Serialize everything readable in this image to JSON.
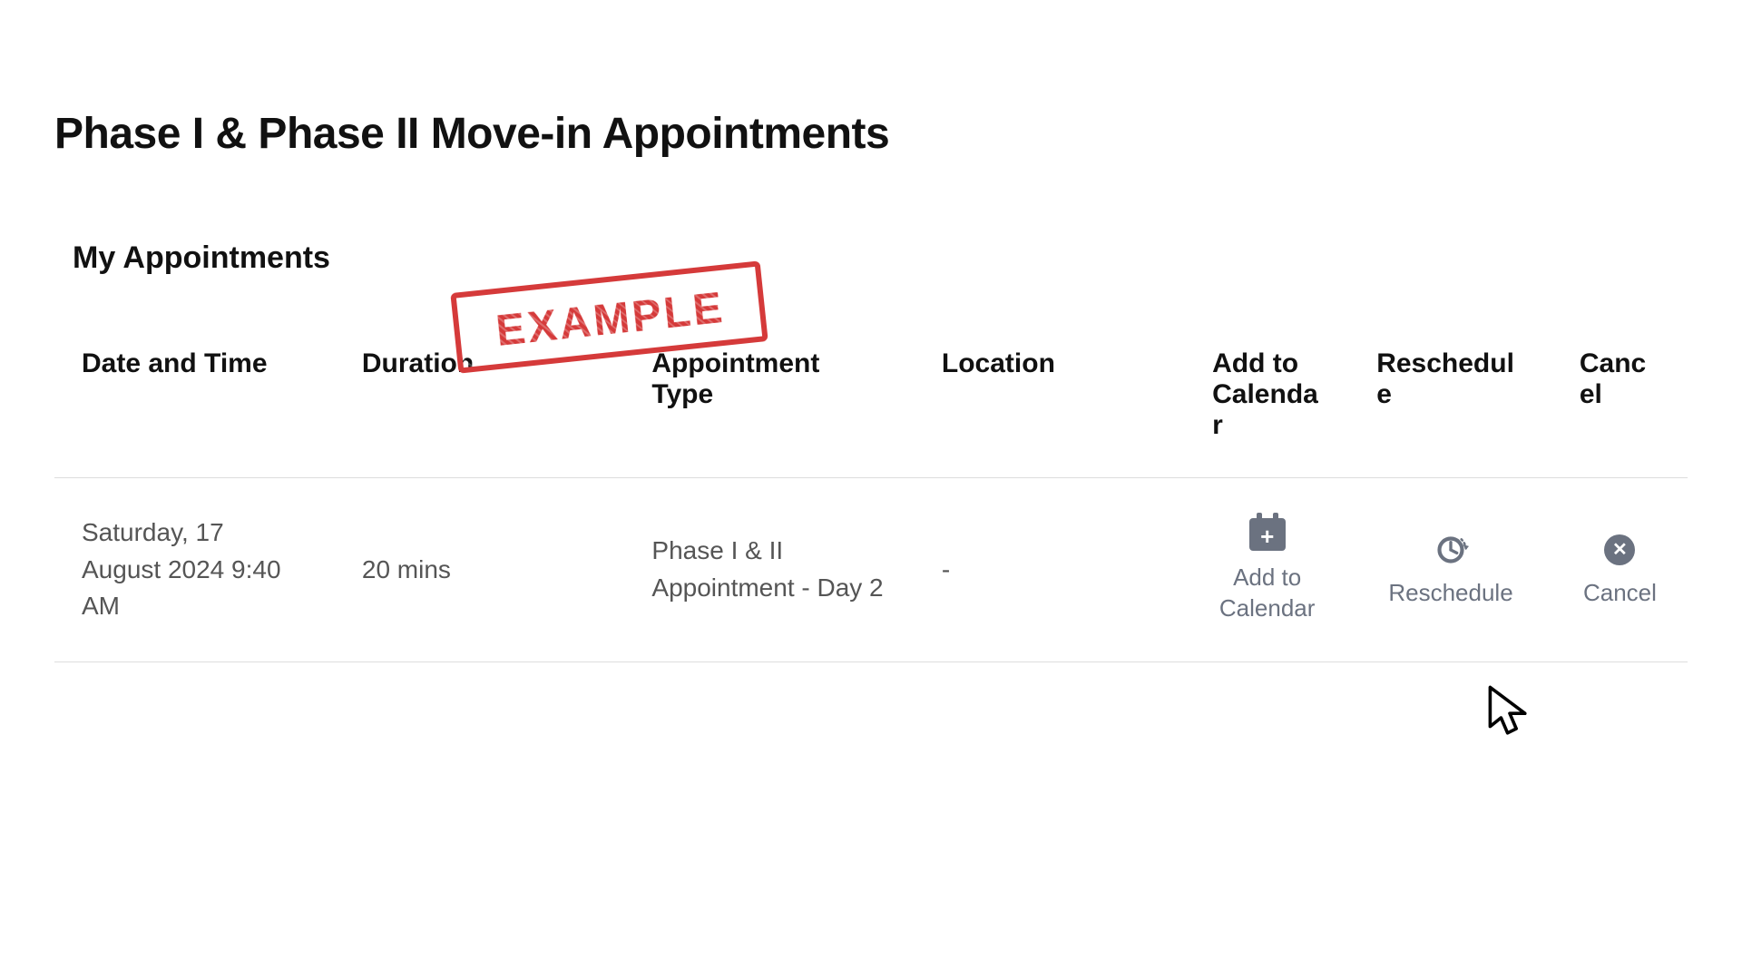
{
  "page_title": "Phase I & Phase II Move-in Appointments",
  "section_title": "My Appointments",
  "stamp_text": "EXAMPLE",
  "table": {
    "headers": {
      "datetime": "Date and Time",
      "duration": "Duration",
      "type": "Appointment Type",
      "location": "Location",
      "add": "Add to Calendar",
      "reschedule": "Reschedule",
      "cancel": "Cancel"
    },
    "rows": [
      {
        "datetime": "Saturday, 17 August 2024 9:40 AM",
        "duration": "20 mins",
        "type": "Phase I & II Appointment - Day 2",
        "location": "-"
      }
    ]
  },
  "actions": {
    "add_label": "Add to Calendar",
    "reschedule_label": "Reschedule",
    "cancel_label": "Cancel"
  }
}
